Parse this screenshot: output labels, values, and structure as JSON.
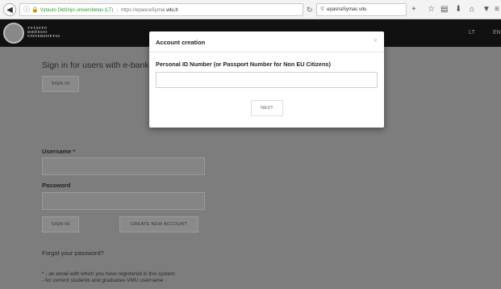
{
  "browser": {
    "site_name": "Vytauto Didžiojo universitetas (LT)",
    "url_prefix": "https://epasiraSymai.",
    "url_domain": "vdu.lt",
    "search_value": "epasiraSymas vdu",
    "icons": [
      "back-icon",
      "info-icon",
      "lock-icon",
      "reload-icon",
      "search-icon",
      "add-tab-icon",
      "star-icon",
      "bookmarks-icon",
      "download-icon",
      "home-icon",
      "pocket-icon",
      "menu-icon"
    ]
  },
  "header": {
    "logo_line1": "VYTAUTO",
    "logo_line2": "DIDŽIOJO",
    "logo_line3": "UNIVERSITETAS",
    "lang_lt": "LT",
    "lang_en": "EN"
  },
  "page": {
    "sso_heading": "Sign in for users with e-banking",
    "sso_button": "SIGN IN",
    "username_label": "Username *",
    "password_label": "Password",
    "signin_button": "SIGN IN",
    "create_button": "CREATE NEW ACCOUNT",
    "forgot": "Forgot your password?",
    "note_line1": "* - an email with which you have registered in this system",
    "note_line2": "- for current students and graduates VMU username"
  },
  "modal": {
    "title": "Account creation",
    "close": "×",
    "field_label": "Personal ID Number (or Passport Number for Non EU Citizens)",
    "field_value": "",
    "next_button": "NEXT"
  },
  "colors": {
    "overlay": "#7d7d7d",
    "header_bg": "#111111",
    "secure_green": "#2e9b39"
  }
}
